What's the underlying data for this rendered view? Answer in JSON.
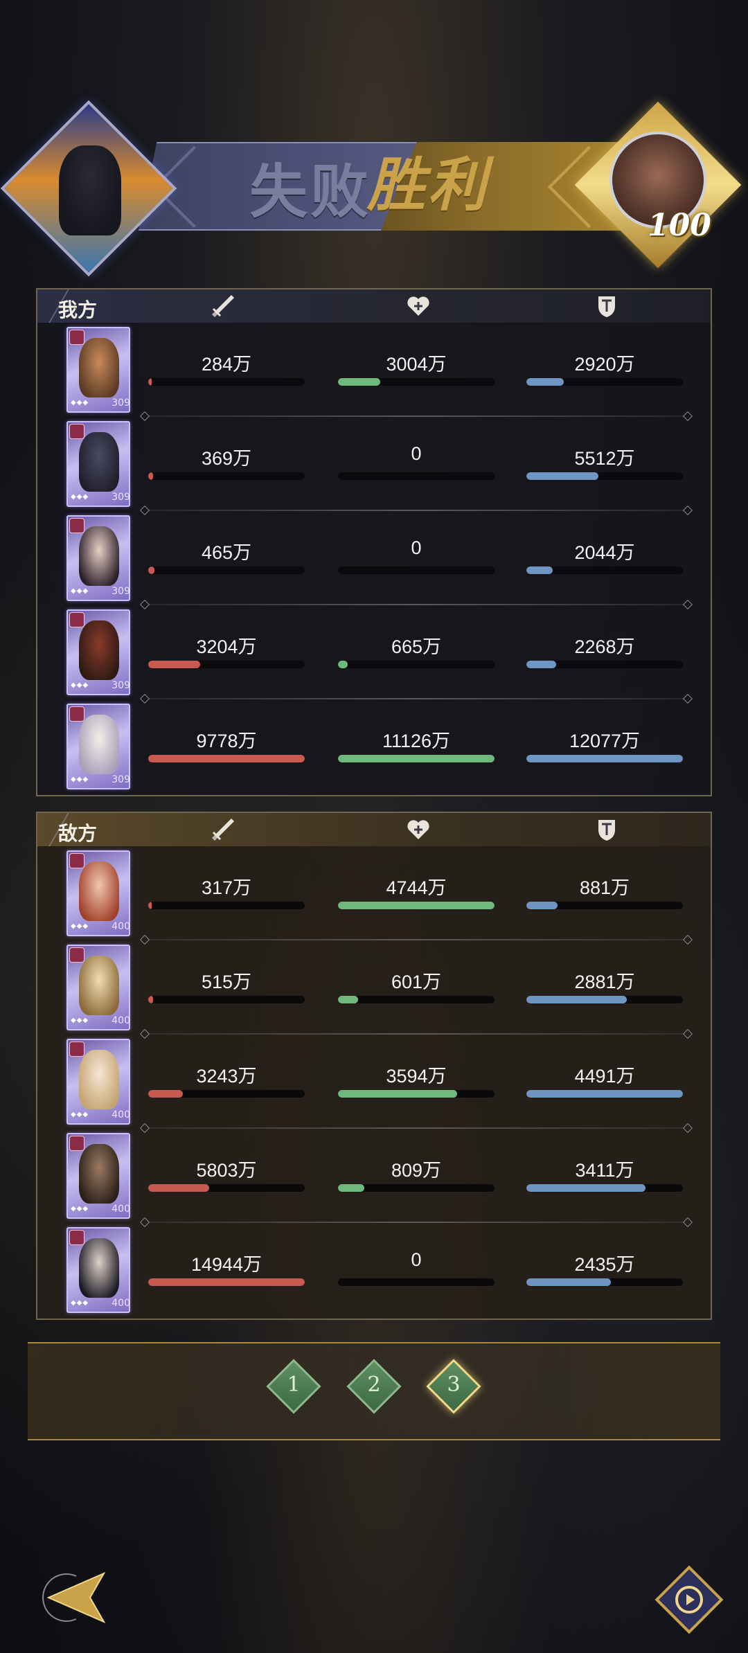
{
  "header": {
    "lose_label": "失败",
    "win_label": "胜利",
    "enemy_level": "100"
  },
  "colors": {
    "attack_bar": "#c85a52",
    "heal_bar": "#6fb97d",
    "defense_bar": "#6f95c2",
    "win_gold": "#c9a24a",
    "lose_purple": "#7a7e9e"
  },
  "icons": {
    "attack": "sword-icon",
    "heal": "heart-icon",
    "defense": "shield-icon",
    "back": "back-arrow-icon",
    "replay": "replay-icon"
  },
  "our_team": {
    "title": "我方",
    "members": [
      {
        "level": "309",
        "attack": "284万",
        "heal": "3004万",
        "defense": "2920万",
        "attack_pct": 2,
        "heal_pct": 27,
        "defense_pct": 24
      },
      {
        "level": "309",
        "attack": "369万",
        "heal": "0",
        "defense": "5512万",
        "attack_pct": 3,
        "heal_pct": 0,
        "defense_pct": 46
      },
      {
        "level": "309",
        "attack": "465万",
        "heal": "0",
        "defense": "2044万",
        "attack_pct": 4,
        "heal_pct": 0,
        "defense_pct": 17
      },
      {
        "level": "309",
        "attack": "3204万",
        "heal": "665万",
        "defense": "2268万",
        "attack_pct": 33,
        "heal_pct": 6,
        "defense_pct": 19
      },
      {
        "level": "309",
        "attack": "9778万",
        "heal": "11126万",
        "defense": "12077万",
        "attack_pct": 100,
        "heal_pct": 100,
        "defense_pct": 100
      }
    ]
  },
  "enemy_team": {
    "title": "敌方",
    "members": [
      {
        "level": "400",
        "attack": "317万",
        "heal": "4744万",
        "defense": "881万",
        "attack_pct": 2,
        "heal_pct": 100,
        "defense_pct": 20
      },
      {
        "level": "400",
        "attack": "515万",
        "heal": "601万",
        "defense": "2881万",
        "attack_pct": 3,
        "heal_pct": 13,
        "defense_pct": 64
      },
      {
        "level": "400",
        "attack": "3243万",
        "heal": "3594万",
        "defense": "4491万",
        "attack_pct": 22,
        "heal_pct": 76,
        "defense_pct": 100
      },
      {
        "level": "400",
        "attack": "5803万",
        "heal": "809万",
        "defense": "3411万",
        "attack_pct": 39,
        "heal_pct": 17,
        "defense_pct": 76
      },
      {
        "level": "400",
        "attack": "14944万",
        "heal": "0",
        "defense": "2435万",
        "attack_pct": 100,
        "heal_pct": 0,
        "defense_pct": 54
      }
    ]
  },
  "pager": {
    "pages": [
      "1",
      "2",
      "3"
    ],
    "active": "3"
  }
}
